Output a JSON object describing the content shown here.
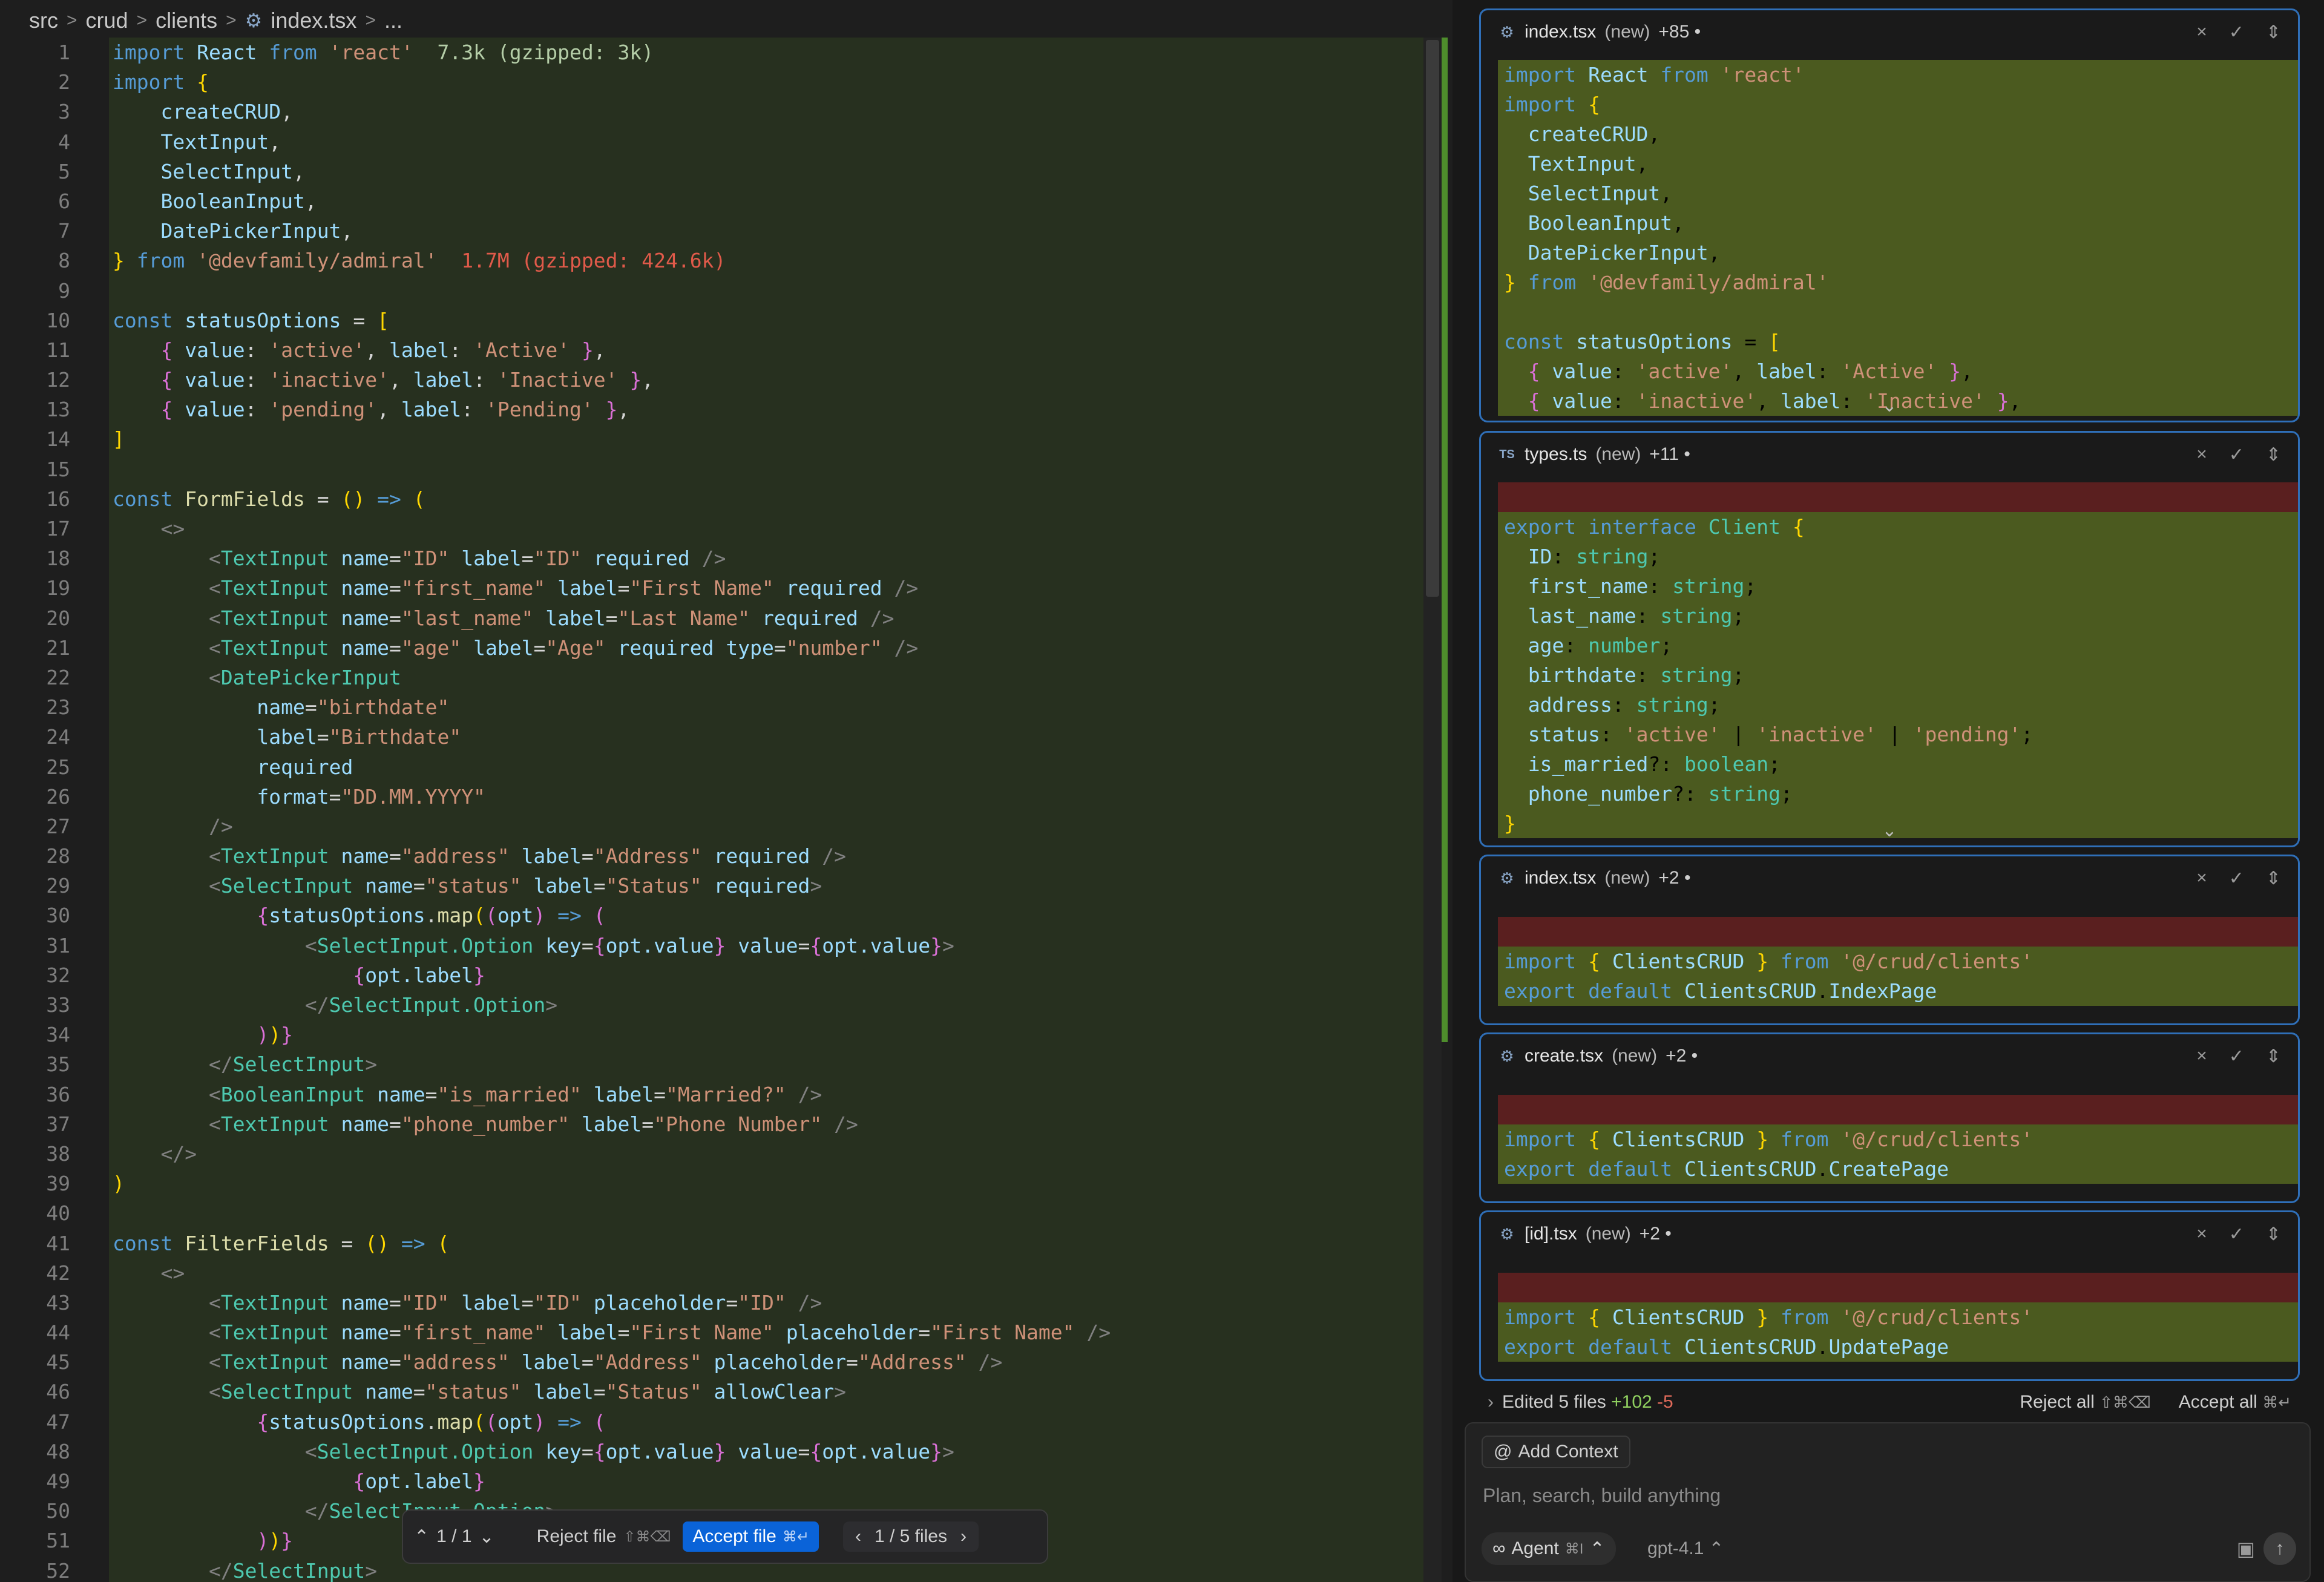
{
  "breadcrumb": {
    "items": [
      "src",
      "crud",
      "clients",
      "index.tsx",
      "..."
    ]
  },
  "editor": {
    "lines": [
      {
        "n": "1",
        "code": "<span class=\"k\">import</span> <span class=\"v\">React</span> <span class=\"k\">from</span> <span class=\"s\">'react'</span>  <span class=\"sz\">7.3k (gzipped: 3k)</span>"
      },
      {
        "n": "2",
        "code": "<span class=\"k\">import</span> <span class=\"b\">{</span>"
      },
      {
        "n": "3",
        "code": "    <span class=\"v\">createCRUD</span>,"
      },
      {
        "n": "4",
        "code": "    <span class=\"v\">TextInput</span>,"
      },
      {
        "n": "5",
        "code": "    <span class=\"v\">SelectInput</span>,"
      },
      {
        "n": "6",
        "code": "    <span class=\"v\">BooleanInput</span>,"
      },
      {
        "n": "7",
        "code": "    <span class=\"v\">DatePickerInput</span>,"
      },
      {
        "n": "8",
        "code": "<span class=\"b\">}</span> <span class=\"k\">from</span> <span class=\"s\">'@devfamily/admiral'</span>  <span class=\"szr\">1.7M (gzipped: 424.6k)</span>"
      },
      {
        "n": "9",
        "code": ""
      },
      {
        "n": "10",
        "code": "<span class=\"k\">const</span> <span class=\"v\">statusOptions</span> = <span class=\"b\">[</span>"
      },
      {
        "n": "11",
        "code": "    <span class=\"p\">{</span> <span class=\"v\">value</span>: <span class=\"s\">'active'</span>, <span class=\"v\">label</span>: <span class=\"s\">'Active'</span> <span class=\"p\">}</span>,"
      },
      {
        "n": "12",
        "code": "    <span class=\"p\">{</span> <span class=\"v\">value</span>: <span class=\"s\">'inactive'</span>, <span class=\"v\">label</span>: <span class=\"s\">'Inactive'</span> <span class=\"p\">}</span>,"
      },
      {
        "n": "13",
        "code": "    <span class=\"p\">{</span> <span class=\"v\">value</span>: <span class=\"s\">'pending'</span>, <span class=\"v\">label</span>: <span class=\"s\">'Pending'</span> <span class=\"p\">}</span>,"
      },
      {
        "n": "14",
        "code": "<span class=\"b\">]</span>"
      },
      {
        "n": "15",
        "code": ""
      },
      {
        "n": "16",
        "code": "<span class=\"k\">const</span> <span class=\"f\">FormFields</span> = <span class=\"b\">()</span> <span class=\"k\">=&gt;</span> <span class=\"b\">(</span>"
      },
      {
        "n": "17",
        "code": "    <span class=\"g\">&lt;&gt;</span>"
      },
      {
        "n": "18",
        "code": "        <span class=\"g\">&lt;</span><span class=\"t\">TextInput</span> <span class=\"v\">name</span>=<span class=\"s\">\"ID\"</span> <span class=\"v\">label</span>=<span class=\"s\">\"ID\"</span> <span class=\"v\">required</span> <span class=\"g\">/&gt;</span>"
      },
      {
        "n": "19",
        "code": "        <span class=\"g\">&lt;</span><span class=\"t\">TextInput</span> <span class=\"v\">name</span>=<span class=\"s\">\"first_name\"</span> <span class=\"v\">label</span>=<span class=\"s\">\"First Name\"</span> <span class=\"v\">required</span> <span class=\"g\">/&gt;</span>"
      },
      {
        "n": "20",
        "code": "        <span class=\"g\">&lt;</span><span class=\"t\">TextInput</span> <span class=\"v\">name</span>=<span class=\"s\">\"last_name\"</span> <span class=\"v\">label</span>=<span class=\"s\">\"Last Name\"</span> <span class=\"v\">required</span> <span class=\"g\">/&gt;</span>"
      },
      {
        "n": "21",
        "code": "        <span class=\"g\">&lt;</span><span class=\"t\">TextInput</span> <span class=\"v\">name</span>=<span class=\"s\">\"age\"</span> <span class=\"v\">label</span>=<span class=\"s\">\"Age\"</span> <span class=\"v\">required</span> <span class=\"v\">type</span>=<span class=\"s\">\"number\"</span> <span class=\"g\">/&gt;</span>"
      },
      {
        "n": "22",
        "code": "        <span class=\"g\">&lt;</span><span class=\"t\">DatePickerInput</span>"
      },
      {
        "n": "23",
        "code": "            <span class=\"v\">name</span>=<span class=\"s\">\"birthdate\"</span>"
      },
      {
        "n": "24",
        "code": "            <span class=\"v\">label</span>=<span class=\"s\">\"Birthdate\"</span>"
      },
      {
        "n": "25",
        "code": "            <span class=\"v\">required</span>"
      },
      {
        "n": "26",
        "code": "            <span class=\"v\">format</span>=<span class=\"s\">\"DD.MM.YYYY\"</span>"
      },
      {
        "n": "27",
        "code": "        <span class=\"g\">/&gt;</span>"
      },
      {
        "n": "28",
        "code": "        <span class=\"g\">&lt;</span><span class=\"t\">TextInput</span> <span class=\"v\">name</span>=<span class=\"s\">\"address\"</span> <span class=\"v\">label</span>=<span class=\"s\">\"Address\"</span> <span class=\"v\">required</span> <span class=\"g\">/&gt;</span>"
      },
      {
        "n": "29",
        "code": "        <span class=\"g\">&lt;</span><span class=\"t\">SelectInput</span> <span class=\"v\">name</span>=<span class=\"s\">\"status\"</span> <span class=\"v\">label</span>=<span class=\"s\">\"Status\"</span> <span class=\"v\">required</span><span class=\"g\">&gt;</span>"
      },
      {
        "n": "30",
        "code": "            <span class=\"p\">{</span><span class=\"v\">statusOptions</span>.<span class=\"f\">map</span><span class=\"b\">(</span><span class=\"p\">(</span><span class=\"v\">opt</span><span class=\"p\">)</span> <span class=\"k\">=&gt;</span> <span class=\"p\">(</span>"
      },
      {
        "n": "31",
        "code": "                <span class=\"g\">&lt;</span><span class=\"t\">SelectInput.Option</span> <span class=\"v\">key</span>=<span class=\"p\">{</span><span class=\"v\">opt.value</span><span class=\"p\">}</span> <span class=\"v\">value</span>=<span class=\"p\">{</span><span class=\"v\">opt.value</span><span class=\"p\">}</span><span class=\"g\">&gt;</span>"
      },
      {
        "n": "32",
        "code": "                    <span class=\"p\">{</span><span class=\"v\">opt.label</span><span class=\"p\">}</span>"
      },
      {
        "n": "33",
        "code": "                <span class=\"g\">&lt;/</span><span class=\"t\">SelectInput.Option</span><span class=\"g\">&gt;</span>"
      },
      {
        "n": "34",
        "code": "            <span class=\"p\">)</span><span class=\"b\">)</span><span class=\"p\">}</span>"
      },
      {
        "n": "35",
        "code": "        <span class=\"g\">&lt;/</span><span class=\"t\">SelectInput</span><span class=\"g\">&gt;</span>"
      },
      {
        "n": "36",
        "code": "        <span class=\"g\">&lt;</span><span class=\"t\">BooleanInput</span> <span class=\"v\">name</span>=<span class=\"s\">\"is_married\"</span> <span class=\"v\">label</span>=<span class=\"s\">\"Married?\"</span> <span class=\"g\">/&gt;</span>"
      },
      {
        "n": "37",
        "code": "        <span class=\"g\">&lt;</span><span class=\"t\">TextInput</span> <span class=\"v\">name</span>=<span class=\"s\">\"phone_number\"</span> <span class=\"v\">label</span>=<span class=\"s\">\"Phone Number\"</span> <span class=\"g\">/&gt;</span>"
      },
      {
        "n": "38",
        "code": "    <span class=\"g\">&lt;/&gt;</span>"
      },
      {
        "n": "39",
        "code": "<span class=\"b\">)</span>"
      },
      {
        "n": "40",
        "code": ""
      },
      {
        "n": "41",
        "code": "<span class=\"k\">const</span> <span class=\"f\">FilterFields</span> = <span class=\"b\">()</span> <span class=\"k\">=&gt;</span> <span class=\"b\">(</span>"
      },
      {
        "n": "42",
        "code": "    <span class=\"g\">&lt;&gt;</span>"
      },
      {
        "n": "43",
        "code": "        <span class=\"g\">&lt;</span><span class=\"t\">TextInput</span> <span class=\"v\">name</span>=<span class=\"s\">\"ID\"</span> <span class=\"v\">label</span>=<span class=\"s\">\"ID\"</span> <span class=\"v\">placeholder</span>=<span class=\"s\">\"ID\"</span> <span class=\"g\">/&gt;</span>"
      },
      {
        "n": "44",
        "code": "        <span class=\"g\">&lt;</span><span class=\"t\">TextInput</span> <span class=\"v\">name</span>=<span class=\"s\">\"first_name\"</span> <span class=\"v\">label</span>=<span class=\"s\">\"First Name\"</span> <span class=\"v\">placeholder</span>=<span class=\"s\">\"First Name\"</span> <span class=\"g\">/&gt;</span>"
      },
      {
        "n": "45",
        "code": "        <span class=\"g\">&lt;</span><span class=\"t\">TextInput</span> <span class=\"v\">name</span>=<span class=\"s\">\"address\"</span> <span class=\"v\">label</span>=<span class=\"s\">\"Address\"</span> <span class=\"v\">placeholder</span>=<span class=\"s\">\"Address\"</span> <span class=\"g\">/&gt;</span>"
      },
      {
        "n": "46",
        "code": "        <span class=\"g\">&lt;</span><span class=\"t\">SelectInput</span> <span class=\"v\">name</span>=<span class=\"s\">\"status\"</span> <span class=\"v\">label</span>=<span class=\"s\">\"Status\"</span> <span class=\"v\">allowClear</span><span class=\"g\">&gt;</span>"
      },
      {
        "n": "47",
        "code": "            <span class=\"p\">{</span><span class=\"v\">statusOptions</span>.<span class=\"f\">map</span><span class=\"b\">(</span><span class=\"p\">(</span><span class=\"v\">opt</span><span class=\"p\">)</span> <span class=\"k\">=&gt;</span> <span class=\"p\">(</span>"
      },
      {
        "n": "48",
        "code": "                <span class=\"g\">&lt;</span><span class=\"t\">SelectInput.Option</span> <span class=\"v\">key</span>=<span class=\"p\">{</span><span class=\"v\">opt.value</span><span class=\"p\">}</span> <span class=\"v\">value</span>=<span class=\"p\">{</span><span class=\"v\">opt.value</span><span class=\"p\">}</span><span class=\"g\">&gt;</span>"
      },
      {
        "n": "49",
        "code": "                    <span class=\"p\">{</span><span class=\"v\">opt.label</span><span class=\"p\">}</span>"
      },
      {
        "n": "50",
        "code": "                <span class=\"g\">&lt;/</span><span class=\"t\">SelectInput.Option</span><span class=\"g\">&gt;</span>"
      },
      {
        "n": "51",
        "code": "            <span class=\"p\">)</span><span class=\"b\">)</span><span class=\"p\">}</span>"
      },
      {
        "n": "52",
        "code": "        <span class=\"g\">&lt;/</span><span class=\"t\">SelectInput</span><span class=\"g\">&gt;</span>"
      }
    ]
  },
  "review_bar": {
    "hunk_counter": "1 / 1",
    "reject_label": "Reject file",
    "reject_kbd": "⇧⌘⌫",
    "accept_label": "Accept file",
    "accept_kbd": "⌘↵",
    "files_counter": "1 / 5 files"
  },
  "cards": [
    {
      "filename": "index.tsx",
      "status": "(new)",
      "count": "+85 •",
      "lines": [
        {
          "type": "add",
          "code": "<span class=\"k\">import</span> <span class=\"v\">React</span> <span class=\"k\">from</span> <span class=\"s\">'react'</span>"
        },
        {
          "type": "add",
          "code": "<span class=\"k\">import</span> <span class=\"b\">{</span>"
        },
        {
          "type": "add",
          "code": "  <span class=\"v\">createCRUD</span>,"
        },
        {
          "type": "add",
          "code": "  <span class=\"v\">TextInput</span>,"
        },
        {
          "type": "add",
          "code": "  <span class=\"v\">SelectInput</span>,"
        },
        {
          "type": "add",
          "code": "  <span class=\"v\">BooleanInput</span>,"
        },
        {
          "type": "add",
          "code": "  <span class=\"v\">DatePickerInput</span>,"
        },
        {
          "type": "add",
          "code": "<span class=\"b\">}</span> <span class=\"k\">from</span> <span class=\"s\">'@devfamily/admiral'</span>"
        },
        {
          "type": "add",
          "code": ""
        },
        {
          "type": "add",
          "code": "<span class=\"k\">const</span> <span class=\"v\">statusOptions</span> = <span class=\"b\">[</span>"
        },
        {
          "type": "add",
          "code": "  <span class=\"p\">{</span> <span class=\"v\">value</span>: <span class=\"s\">'active'</span>, <span class=\"v\">label</span>: <span class=\"s\">'Active'</span> <span class=\"p\">}</span>,"
        },
        {
          "type": "add",
          "code": "  <span class=\"p\">{</span> <span class=\"v\">value</span>: <span class=\"s\">'inactive'</span>, <span class=\"v\">label</span>: <span class=\"s\">'Inactive'</span> <span class=\"p\">}</span>,"
        }
      ]
    },
    {
      "filename": "types.ts",
      "status": "(new)",
      "count": "+11 •",
      "lines": [
        {
          "type": "del",
          "code": ""
        },
        {
          "type": "add",
          "code": "<span class=\"k\">export</span> <span class=\"k\">interface</span> <span class=\"t\">Client</span> <span class=\"b\">{</span>"
        },
        {
          "type": "add",
          "code": "  <span class=\"v\">ID</span>: <span class=\"t\">string</span>;"
        },
        {
          "type": "add",
          "code": "  <span class=\"v\">first_name</span>: <span class=\"t\">string</span>;"
        },
        {
          "type": "add",
          "code": "  <span class=\"v\">last_name</span>: <span class=\"t\">string</span>;"
        },
        {
          "type": "add",
          "code": "  <span class=\"v\">age</span>: <span class=\"t\">number</span>;"
        },
        {
          "type": "add",
          "code": "  <span class=\"v\">birthdate</span>: <span class=\"t\">string</span>;"
        },
        {
          "type": "add",
          "code": "  <span class=\"v\">address</span>: <span class=\"t\">string</span>;"
        },
        {
          "type": "add",
          "code": "  <span class=\"v\">status</span>: <span class=\"s\">'active'</span> | <span class=\"s\">'inactive'</span> | <span class=\"s\">'pending'</span>;"
        },
        {
          "type": "add",
          "code": "  <span class=\"v\">is_married</span>?: <span class=\"t\">boolean</span>;"
        },
        {
          "type": "add",
          "code": "  <span class=\"v\">phone_number</span>?: <span class=\"t\">string</span>;"
        },
        {
          "type": "add",
          "code": "<span class=\"b\">}</span>"
        }
      ]
    },
    {
      "filename": "index.tsx",
      "status": "(new)",
      "count": "+2 •",
      "lines": [
        {
          "type": "del",
          "code": ""
        },
        {
          "type": "add",
          "code": "<span class=\"k\">import</span> <span class=\"b\">{</span> <span class=\"v\">ClientsCRUD</span> <span class=\"b\">}</span> <span class=\"k\">from</span> <span class=\"s\">'@/crud/clients'</span>"
        },
        {
          "type": "add",
          "code": "<span class=\"k\">export</span> <span class=\"k\">default</span> <span class=\"v\">ClientsCRUD</span>.<span class=\"v\">IndexPage</span>"
        }
      ]
    },
    {
      "filename": "create.tsx",
      "status": "(new)",
      "count": "+2 •",
      "lines": [
        {
          "type": "del",
          "code": ""
        },
        {
          "type": "add",
          "code": "<span class=\"k\">import</span> <span class=\"b\">{</span> <span class=\"v\">ClientsCRUD</span> <span class=\"b\">}</span> <span class=\"k\">from</span> <span class=\"s\">'@/crud/clients'</span>"
        },
        {
          "type": "add",
          "code": "<span class=\"k\">export</span> <span class=\"k\">default</span> <span class=\"v\">ClientsCRUD</span>.<span class=\"v\">CreatePage</span>"
        }
      ]
    },
    {
      "filename": "[id].tsx",
      "status": "(new)",
      "count": "+2 •",
      "lines": [
        {
          "type": "del",
          "code": ""
        },
        {
          "type": "add",
          "code": "<span class=\"k\">import</span> <span class=\"b\">{</span> <span class=\"v\">ClientsCRUD</span> <span class=\"b\">}</span> <span class=\"k\">from</span> <span class=\"s\">'@/crud/clients'</span>"
        },
        {
          "type": "add",
          "code": "<span class=\"k\">export</span> <span class=\"k\">default</span> <span class=\"v\">ClientsCRUD</span>.<span class=\"v\">UpdatePage</span>"
        }
      ]
    }
  ],
  "edited": {
    "label": "Edited 5 files",
    "added": "+102",
    "removed": "-5",
    "reject_all": "Reject all",
    "reject_all_kbd": "⇧⌘⌫",
    "accept_all": "Accept all",
    "accept_all_kbd": "⌘↵"
  },
  "chat": {
    "add_context": "Add Context",
    "placeholder": "Plan, search, build anything",
    "agent_label": "Agent",
    "agent_kbd": "⌘I",
    "model": "gpt-4.1"
  },
  "colors": {
    "accent": "#0a63d8",
    "card_border": "#2f6fb8",
    "added_bg": "#4b5a1f",
    "removed_bg": "#5a1f1f"
  }
}
